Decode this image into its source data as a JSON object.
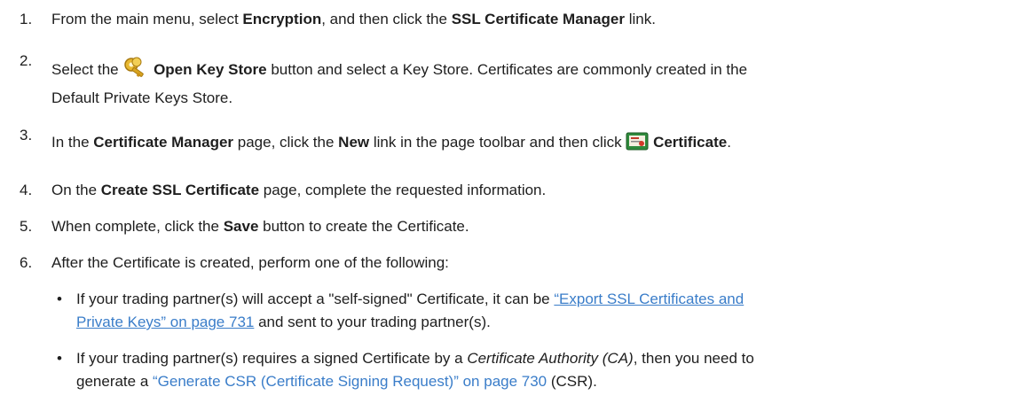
{
  "steps": [
    {
      "num": "1.",
      "t1": "From the main menu, select ",
      "b1": "Encryption",
      "t2": ", and then click the ",
      "b2": "SSL Certificate Manager",
      "t3": " link."
    },
    {
      "num": "2.",
      "t1": "Select the ",
      "b1": "Open Key Store",
      "t2": " button and select a Key Store. Certificates are commonly created in the",
      "t3": "Default Private Keys Store."
    },
    {
      "num": "3.",
      "t1": "In the ",
      "b1": "Certificate Manager",
      "t2": " page, click the  ",
      "b2": "New",
      "t3": " link in the page toolbar and then click ",
      "b3": "Certificate",
      "t4": "."
    },
    {
      "num": "4.",
      "t1": "On the ",
      "b1": "Create SSL Certificate",
      "t2": " page, complete the requested information."
    },
    {
      "num": "5.",
      "t1": "When complete, click the ",
      "b1": "Save",
      "t2": " button to create the Certificate."
    },
    {
      "num": "6.",
      "t1": "After the Certificate is created, perform one of the following:"
    }
  ],
  "bullets": [
    {
      "dot": "•",
      "t1": "If your trading partner(s) will accept a \"self-signed\" Certificate, it can be ",
      "link1": "“Export SSL Certificates and",
      "link2": "Private Keys” on page 731",
      "t2": " and sent to your trading partner(s)."
    },
    {
      "dot": "•",
      "t1": "If your trading partner(s) requires a signed Certificate by a ",
      "i1": "Certificate Authority (CA)",
      "t2": ", then you need to",
      "t3": "generate a ",
      "link1": "“Generate CSR (Certificate Signing Request)” on page 730",
      "t4": " (CSR)."
    }
  ],
  "icons": {
    "step2": "key-store-icon",
    "step3": "certificate-icon"
  },
  "colors": {
    "text": "#1e1e1e",
    "link": "#3a7dc9"
  }
}
